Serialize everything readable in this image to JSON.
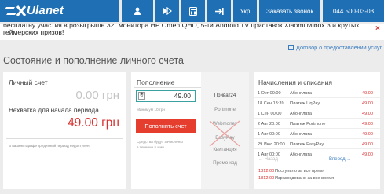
{
  "header": {
    "logo_text": "Ulanet",
    "lang_label": "Укр",
    "callback_label": "Заказать звонок",
    "phone": "044 500-03-03",
    "icons": [
      "user-icon",
      "play-icon",
      "calculator-icon",
      "logout-icon"
    ],
    "brand_color": "#1e6fb4"
  },
  "notice": {
    "text": "бесплатну участия в розыгрыше 32\" монитора HP Omen QHD, 5-ти Android TV приставок Xiaomi Mibox 3 и крутых геймерских призов!",
    "close_label": "×"
  },
  "contract_link": "Договор о предоставлении услуг",
  "page_title": "Состояние и пополнение личного счета",
  "account": {
    "title": "Личный счет",
    "balance": "0.00 грн",
    "shortage_label": "Нехватка для начала периода",
    "shortage_value": "49.00 грн",
    "credit_note": "В вашем тарифе кредитный период недоступен."
  },
  "topup": {
    "title": "Пополнение",
    "currency_symbol": "₴",
    "amount": "49.00",
    "min_note": "Минимум 10 грн",
    "button_label": "Пополнить счет",
    "credit_note_line1": "Средства будут зачислены",
    "credit_note_line2": "в течение 5 мин."
  },
  "methods": [
    "Приват24",
    "Portmone",
    "Webmoney",
    "EasyPay",
    "Квитанция",
    "Промо-код"
  ],
  "methods_state": {
    "active": "Приват24",
    "unavailable": "EasyPay"
  },
  "charges": {
    "title": "Начисления и списания",
    "rows": [
      {
        "date": "1 Окт 00:00",
        "desc": "Абонплата",
        "amount": "49.00"
      },
      {
        "date": "18 Сен 13:39",
        "desc": "Платеж LiqPay",
        "amount": "49.00"
      },
      {
        "date": "1 Сен 00:00",
        "desc": "Абонплата",
        "amount": "49.00"
      },
      {
        "date": "2 Авг 20:00",
        "desc": "Платеж Portmone",
        "amount": "49.00"
      },
      {
        "date": "1 Авг 00:00",
        "desc": "Абонплата",
        "amount": "49.00"
      },
      {
        "date": "29 Июл 20:00",
        "desc": "Платеж EasyPay",
        "amount": "49.00"
      },
      {
        "date": "1 Авг 00:00",
        "desc": "Абонплата",
        "amount": "49.00"
      }
    ],
    "prev_label": "← Назад",
    "next_label": "Вперед →",
    "total_in_value": "1812.00",
    "total_in_label": "Поступило за все время",
    "total_out_value": "1812.00",
    "total_out_label": "Израсходовано за все время"
  },
  "colors": {
    "accent": "#e53e2e",
    "link": "#3a7cc0",
    "input_border": "#3aa1a1"
  }
}
